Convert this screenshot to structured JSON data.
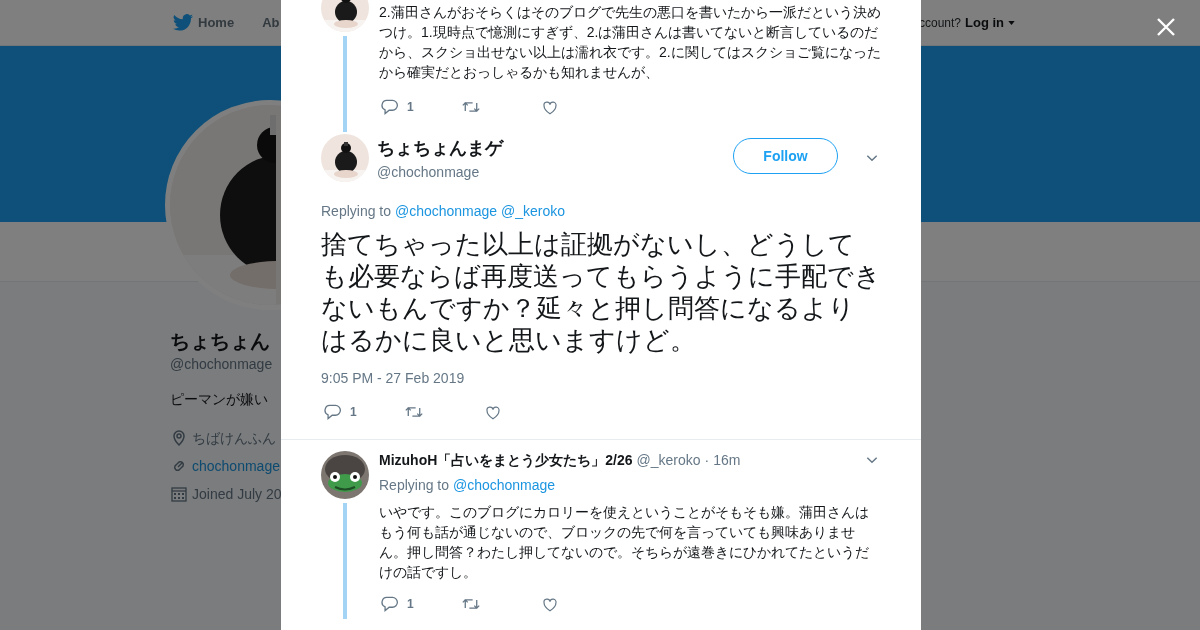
{
  "nav": {
    "items": [
      "Home",
      "Ab"
    ],
    "account_prompt": "ccount?",
    "login": "Log in"
  },
  "profile": {
    "name": "ちょちょん",
    "handle": "@chochonmage",
    "bio": "ピーマンが嫌い",
    "location": "ちばけんふん",
    "link": "chochonmage",
    "joined": "Joined July 20"
  },
  "tweets": [
    {
      "kind": "context",
      "text": "2.蒲田さんがおそらくはそのブログで先生の悪口を書いたから一派だという決めつけ。1.現時点で憶測にすぎず、2.は蒲田さんは書いてないと断言しているのだから、スクショ出せない以上は濡れ衣です。2.に関してはスクショご覧になったから確実だとおっしゃるかも知れませんが、",
      "replies": "1"
    },
    {
      "kind": "focus",
      "name": "ちょちょんまゲ",
      "handle": "@chochonmage",
      "follow": "Follow",
      "replying_label": "Replying to",
      "replying_to": [
        "@chochonmage",
        "@_keroko"
      ],
      "text": "捨てちゃった以上は証拠がないし、どうしても必要ならば再度送ってもらうように手配できないもんですか？延々と押し問答になるよりはるかに良いと思いますけど。",
      "timestamp": "9:05 PM - 27 Feb 2019",
      "replies": "1"
    },
    {
      "kind": "reply",
      "name": "MizuhoH「占いをまとう少女たち」2/26",
      "handle": "@_keroko",
      "time": "· 16m",
      "replying_label": "Replying to",
      "replying_to": [
        "@chochonmage"
      ],
      "text": "いやです。このブログにカロリーを使えということがそもそも嫌。蒲田さんはもう何も話が通じないので、ブロックの先で何を言っていても興味ありません。押し問答？わたし押してないので。そちらが遠巻きにひかれてたというだけの話ですし。",
      "replies": "1"
    }
  ]
}
